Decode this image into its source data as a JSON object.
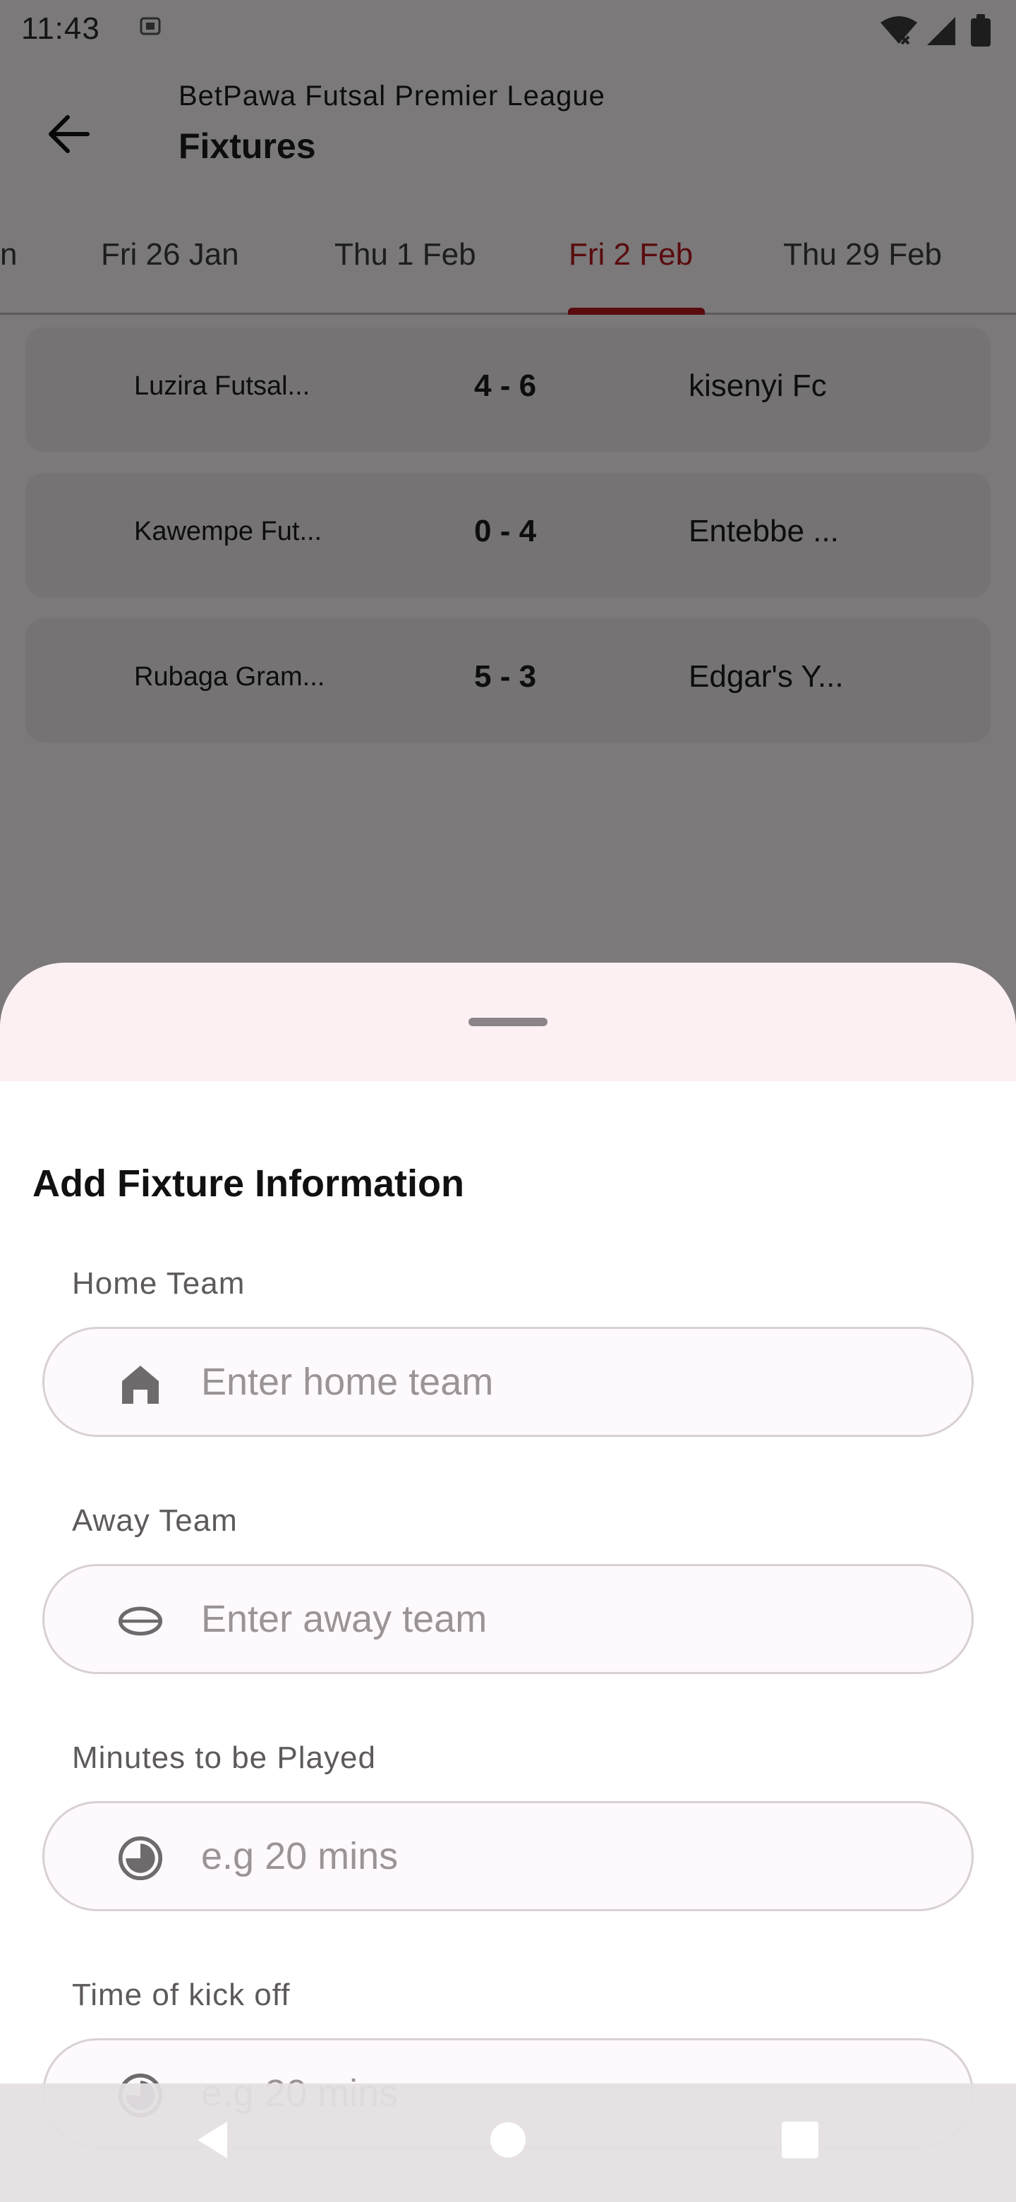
{
  "status_bar": {
    "time": "11:43"
  },
  "header": {
    "subtitle": "BetPawa Futsal Premier League",
    "title": "Fixtures"
  },
  "tabs": [
    {
      "label": "n",
      "active": false
    },
    {
      "label": "Fri 26 Jan",
      "active": false
    },
    {
      "label": "Thu 1 Feb",
      "active": false
    },
    {
      "label": "Fri 2 Feb",
      "active": true
    },
    {
      "label": "Thu 29 Feb",
      "active": false
    }
  ],
  "fixtures": [
    {
      "home": "Luzira Futsal...",
      "score": "4 - 6",
      "away": "kisenyi Fc"
    },
    {
      "home": "Kawempe Fut...",
      "score": "0 - 4",
      "away": "Entebbe ..."
    },
    {
      "home": "Rubaga Gram...",
      "score": "5 - 3",
      "away": "Edgar's Y..."
    }
  ],
  "sheet": {
    "title": "Add Fixture Information",
    "fields": [
      {
        "label": "Home Team",
        "placeholder": "Enter home team",
        "icon": "home-icon"
      },
      {
        "label": "Away Team",
        "placeholder": "Enter away team",
        "icon": "ball-icon"
      },
      {
        "label": "Minutes to be Played",
        "placeholder": "e.g 20 mins",
        "icon": "timer-icon"
      },
      {
        "label": "Time of kick off",
        "placeholder": "e.g 20 mins",
        "icon": "timer-icon"
      }
    ]
  },
  "nav_bar": {
    "icons": [
      "back-triangle-icon",
      "home-circle-icon",
      "recents-square-icon"
    ]
  },
  "colors": {
    "accent": "#b3171d",
    "sheet_top": "#fcf0f3",
    "field_bg": "#fef9fc"
  }
}
